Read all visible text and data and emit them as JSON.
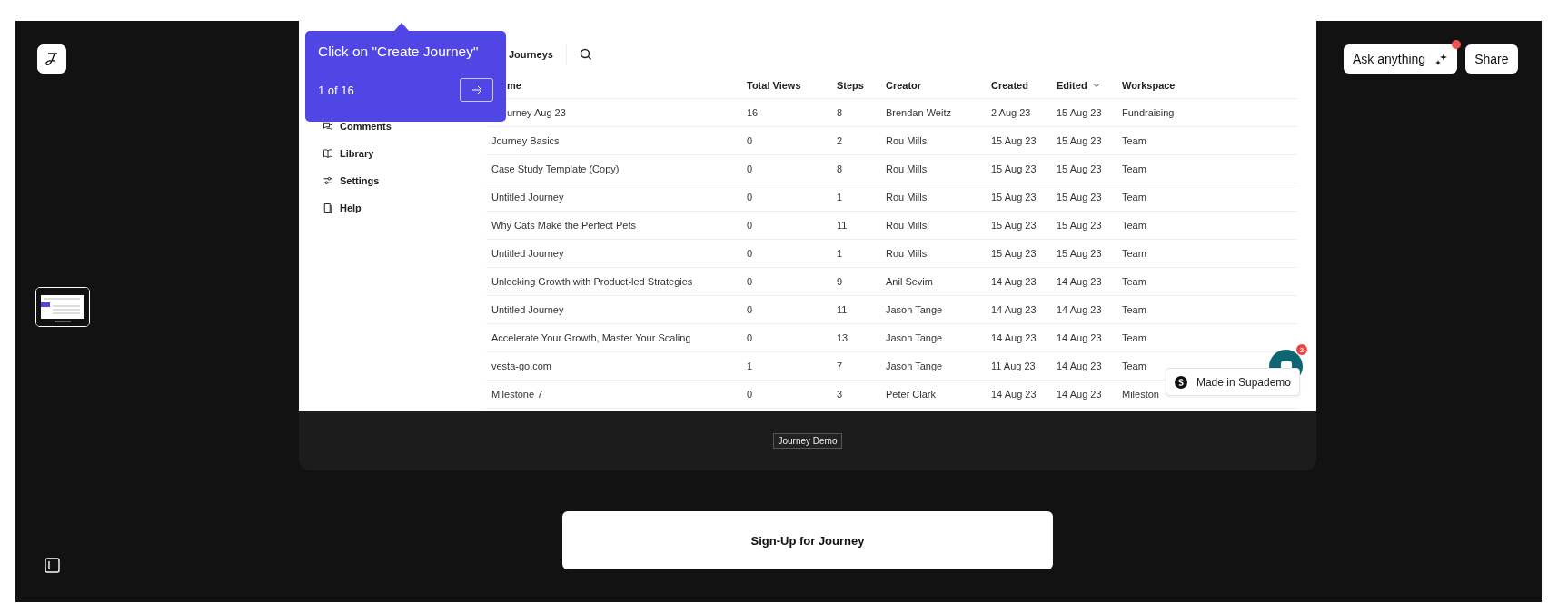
{
  "actions": [
    {
      "label": "Ask anything",
      "kind": "ask",
      "notification": true
    },
    {
      "label": "Share",
      "kind": "plain",
      "notification": false
    }
  ],
  "tooltip": {
    "title": "Click on \"Create Journey\"",
    "progress": "1 of 16"
  },
  "sidebar": {
    "items": [
      {
        "label": "Comments"
      },
      {
        "label": "Library"
      },
      {
        "label": "Settings"
      },
      {
        "label": "Help"
      }
    ]
  },
  "topbar": {
    "title": "Journeys"
  },
  "table": {
    "columns": [
      {
        "label": "me",
        "sorted": false
      },
      {
        "label": "Total Views",
        "sorted": false
      },
      {
        "label": "Steps",
        "sorted": false
      },
      {
        "label": "Creator",
        "sorted": false
      },
      {
        "label": "Created",
        "sorted": false
      },
      {
        "label": "Edited",
        "sorted": true
      },
      {
        "label": "Workspace",
        "sorted": false
      }
    ],
    "rows": [
      [
        "urney Aug 23",
        "16",
        "8",
        "Brendan Weitz",
        "2 Aug 23",
        "15 Aug 23",
        "Fundraising"
      ],
      [
        "Journey Basics",
        "0",
        "2",
        "Rou Mills",
        "15 Aug 23",
        "15 Aug 23",
        "Team"
      ],
      [
        "Case Study Template (Copy)",
        "0",
        "8",
        "Rou Mills",
        "15 Aug 23",
        "15 Aug 23",
        "Team"
      ],
      [
        "Untitled Journey",
        "0",
        "1",
        "Rou Mills",
        "15 Aug 23",
        "15 Aug 23",
        "Team"
      ],
      [
        "Why Cats Make the Perfect Pets",
        "0",
        "11",
        "Rou Mills",
        "15 Aug 23",
        "15 Aug 23",
        "Team"
      ],
      [
        "Untitled Journey",
        "0",
        "1",
        "Rou Mills",
        "15 Aug 23",
        "15 Aug 23",
        "Team"
      ],
      [
        "Unlocking Growth with Product-led Strategies",
        "0",
        "9",
        "Anil Sevim",
        "14 Aug 23",
        "14 Aug 23",
        "Team"
      ],
      [
        "Untitled Journey",
        "0",
        "11",
        "Jason Tange",
        "14 Aug 23",
        "14 Aug 23",
        "Team"
      ],
      [
        "Accelerate Your Growth, Master Your Scaling",
        "0",
        "13",
        "Jason Tange",
        "14 Aug 23",
        "14 Aug 23",
        "Team"
      ],
      [
        "vesta-go.com",
        "1",
        "7",
        "Jason Tange",
        "11 Aug 23",
        "14 Aug 23",
        "Team"
      ],
      [
        "Milestone 7",
        "0",
        "3",
        "Peter Clark",
        "14 Aug 23",
        "14 Aug 23",
        "Mileston"
      ]
    ]
  },
  "chat": {
    "count": "2"
  },
  "badge": {
    "label": "Made in Supademo"
  },
  "demo_label": "Journey Demo",
  "cta": {
    "label": "Sign-Up for Journey"
  }
}
